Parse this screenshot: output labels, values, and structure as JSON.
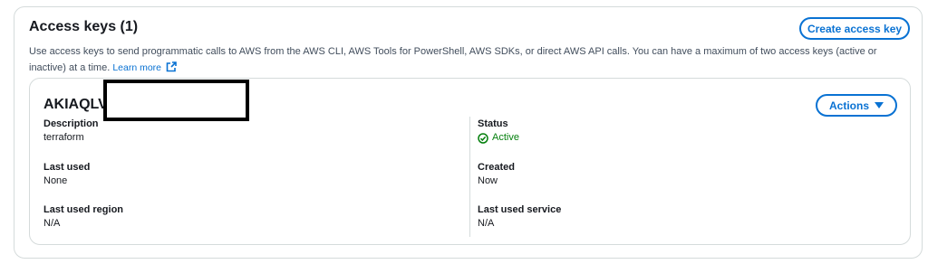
{
  "panel": {
    "title": "Access keys (1)",
    "create_button": "Create access key",
    "description": "Use access keys to send programmatic calls to AWS from the AWS CLI, AWS Tools for PowerShell, AWS SDKs, or direct AWS API calls. You can have a maximum of two access keys (active or inactive) at a time.",
    "learn_more": "Learn more"
  },
  "key": {
    "id": "AKIAQLV",
    "actions_button": "Actions",
    "fields": {
      "description": {
        "label": "Description",
        "value": "terraform"
      },
      "last_used": {
        "label": "Last used",
        "value": "None"
      },
      "last_used_region": {
        "label": "Last used region",
        "value": "N/A"
      },
      "status": {
        "label": "Status",
        "value": "Active"
      },
      "created": {
        "label": "Created",
        "value": "Now"
      },
      "last_used_service": {
        "label": "Last used service",
        "value": "N/A"
      }
    }
  },
  "colors": {
    "link": "#0972d3",
    "status_active": "#037f0c",
    "border": "#d5dbdb"
  },
  "icons": {
    "external_link": "external-link-icon",
    "status": "check-circle-icon",
    "actions": "caret-down-icon"
  }
}
